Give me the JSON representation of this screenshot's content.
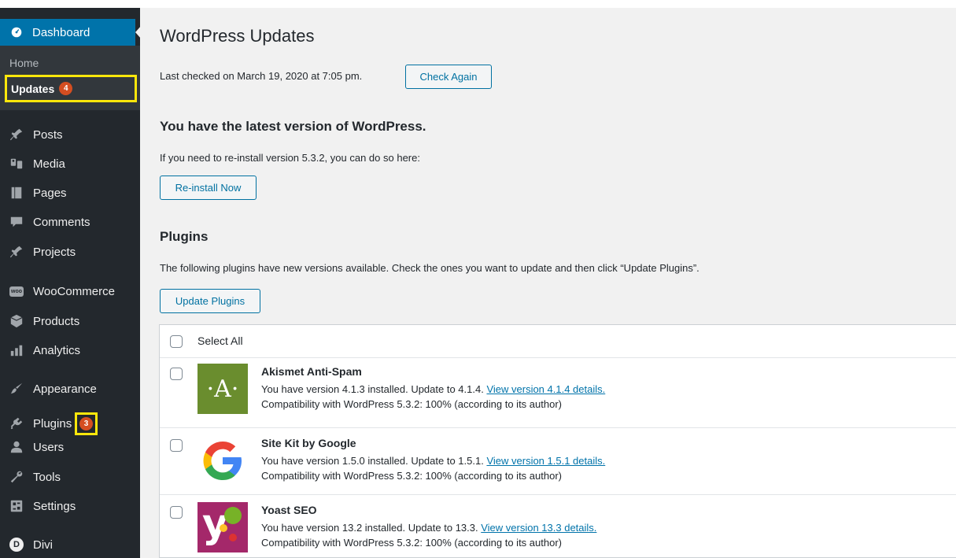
{
  "sidebar": {
    "dashboard": "Dashboard",
    "home": "Home",
    "updates": "Updates",
    "updates_count": "4",
    "items": [
      {
        "label": "Posts",
        "icon": "pin-icon"
      },
      {
        "label": "Media",
        "icon": "media-icon"
      },
      {
        "label": "Pages",
        "icon": "pages-icon"
      },
      {
        "label": "Comments",
        "icon": "comment-icon"
      },
      {
        "label": "Projects",
        "icon": "pin-icon"
      },
      {
        "label": "WooCommerce",
        "icon": "woo-icon"
      },
      {
        "label": "Products",
        "icon": "box-icon"
      },
      {
        "label": "Analytics",
        "icon": "bar-chart-icon"
      },
      {
        "label": "Appearance",
        "icon": "brush-icon"
      },
      {
        "label": "Plugins",
        "icon": "plug-icon"
      },
      {
        "label": "Users",
        "icon": "user-icon"
      },
      {
        "label": "Tools",
        "icon": "wrench-icon"
      },
      {
        "label": "Settings",
        "icon": "settings-icon"
      },
      {
        "label": "Divi",
        "icon": "divi-icon"
      }
    ],
    "plugins_count": "3",
    "woo_badge": "woo",
    "divi_letter": "D"
  },
  "main": {
    "title": "WordPress Updates",
    "last_checked": "Last checked on March 19, 2020 at 7:05 pm.",
    "check_again": "Check Again",
    "latest_heading": "You have the latest version of WordPress.",
    "reinstall_text": "If you need to re-install version 5.3.2, you can do so here:",
    "reinstall_button": "Re-install Now",
    "plugins_heading": "Plugins",
    "plugins_text": "The following plugins have new versions available. Check the ones you want to update and then click “Update Plugins”.",
    "update_plugins_button": "Update Plugins",
    "select_all": "Select All",
    "plugins": [
      {
        "name": "Akismet Anti-Spam",
        "version_text": "You have version 4.1.3 installed. Update to 4.1.4.",
        "details_link": "View version 4.1.4 details.",
        "compat": "Compatibility with WordPress 5.3.2: 100% (according to its author)",
        "logo_text": "·A·"
      },
      {
        "name": "Site Kit by Google",
        "version_text": "You have version 1.5.0 installed. Update to 1.5.1.",
        "details_link": "View version 1.5.1 details.",
        "compat": "Compatibility with WordPress 5.3.2: 100% (according to its author)"
      },
      {
        "name": "Yoast SEO",
        "version_text": "You have version 13.2 installed. Update to 13.3.",
        "details_link": "View version 13.3 details.",
        "compat": "Compatibility with WordPress 5.3.2: 100% (according to its author)",
        "logo_text": "y"
      }
    ]
  },
  "colors": {
    "sidebar_bg": "#23282d",
    "accent": "#0073aa",
    "highlight_box": "#ffe70b",
    "badge": "#d54e21"
  }
}
